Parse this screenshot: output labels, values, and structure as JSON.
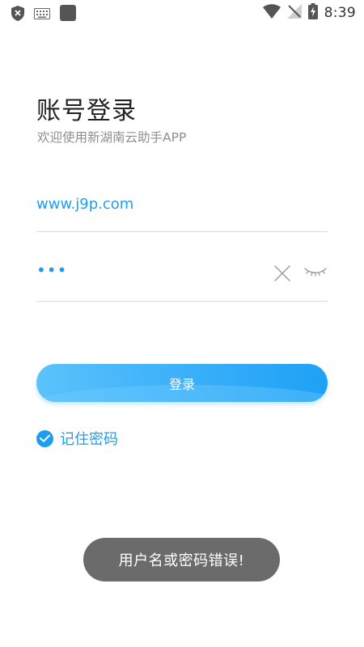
{
  "status_bar": {
    "time": "8:39",
    "icons": [
      "shield-icon",
      "keyboard-icon",
      "app-square-icon",
      "wifi-icon",
      "no-signal-icon",
      "battery-charging-icon"
    ]
  },
  "header": {
    "title": "账号登录",
    "subtitle": "欢迎使用新湖南云助手APP"
  },
  "form": {
    "username_value": "www.j9p.com",
    "password_masked": "•••",
    "login_label": "登录",
    "remember_label": "记住密码",
    "remember_checked": true
  },
  "toast": {
    "message": "用户名或密码错误!"
  },
  "colors": {
    "accent": "#1e9ef0",
    "toast_bg": "#6b6b6b",
    "divider": "#d9d9d9"
  }
}
